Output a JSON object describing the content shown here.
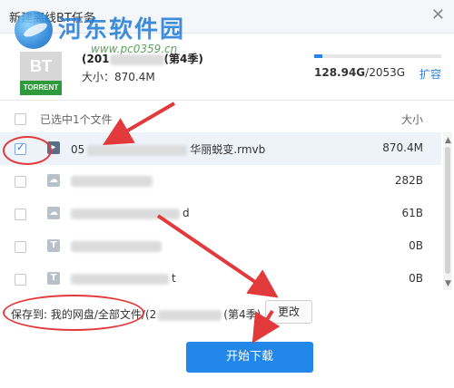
{
  "window": {
    "title": "新建离线BT任务",
    "close": "✕"
  },
  "watermark": {
    "name": "河东软件园",
    "url": "www.pc0359.cn"
  },
  "torrent_icon": {
    "top_text": "BT",
    "bottom_text": "TORRENT"
  },
  "task": {
    "name_prefix": "(201",
    "name_suffix": "(第4季)",
    "size_label": "大小：",
    "size_value": "870.4M"
  },
  "space": {
    "used": "128.94G",
    "total": "/2053G",
    "used_fraction": 0.063,
    "expand_label": "扩容",
    "bar_color": "#2a82e4"
  },
  "list": {
    "header_label": "已选中1个文件",
    "header_size": "大小",
    "files": [
      {
        "name_start": "05",
        "name_end": "华丽蜕变.rmvb",
        "size": "870.4M",
        "icon": "video-icon",
        "checked": true
      },
      {
        "name_start": "",
        "name_end": "",
        "size": "282B",
        "icon": "cloud-file-icon",
        "checked": false
      },
      {
        "name_start": "",
        "name_end": "d",
        "size": "61B",
        "icon": "cloud-file-icon",
        "checked": false
      },
      {
        "name_start": "",
        "name_end": "",
        "size": "0B",
        "icon": "text-file-icon",
        "checked": false
      },
      {
        "name_start": "",
        "name_end": "t",
        "size": "0B",
        "icon": "text-file-icon",
        "checked": false
      }
    ]
  },
  "save": {
    "label": "保存到:",
    "path_start": "我的网盘/全部文件/(2",
    "path_end": "(第4季)",
    "change_label": "更改"
  },
  "actions": {
    "start_label": "开始下载",
    "accent": "#2287e8"
  },
  "annotation_color": "#e23a3a"
}
